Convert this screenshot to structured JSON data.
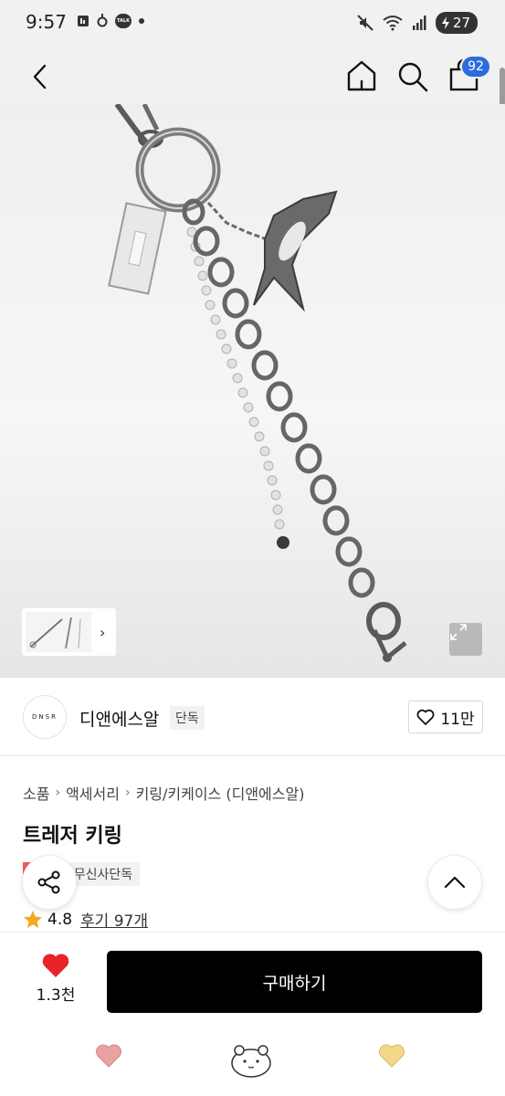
{
  "status_bar": {
    "time": "9:57",
    "battery": "27",
    "talk_label": "TALK",
    "icons_left": [
      "message-icon",
      "location-icon",
      "kakaotalk-icon",
      "dot-icon"
    ],
    "icons_right": [
      "mute-icon",
      "wifi-icon",
      "signal-icon",
      "battery-icon"
    ]
  },
  "header": {
    "cart_count": "92"
  },
  "gallery": {
    "thumb_next": "›"
  },
  "brand": {
    "logo_text": "DNSR",
    "name": "디앤에스알",
    "tag": "단독",
    "likes": "11만"
  },
  "breadcrumb": {
    "items": [
      "소품",
      "액세서리",
      "키링/키케이스 (디앤에스알)"
    ],
    "separator": "›"
  },
  "product": {
    "title": "트레저 키링",
    "tag_sale": "세일",
    "tag_exclusive": "무신사단독",
    "rating": "4.8",
    "reviews": "후기 97개"
  },
  "purchase": {
    "wish_count": "1.3천",
    "buy_label": "구매하기"
  },
  "colors": {
    "accent_blue": "#2d6cdf",
    "sale_red": "#f25a4f",
    "heart_red": "#e8232c",
    "star_orange": "#f5a623",
    "buy_black": "#000000"
  }
}
